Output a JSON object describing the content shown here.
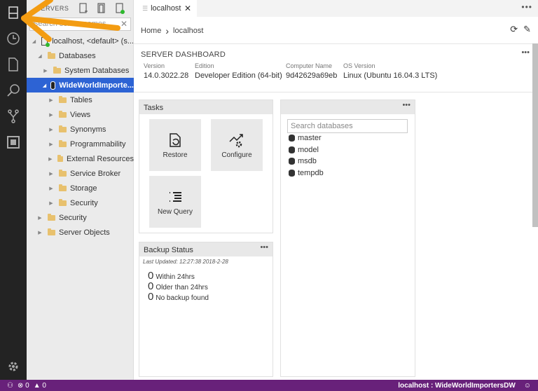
{
  "sidebar": {
    "header": "SERVERS",
    "search_placeholder": "Search server names",
    "tree": [
      {
        "label": "localhost, <default> (s...",
        "level": 0,
        "expanded": true,
        "icon": "server-icon"
      },
      {
        "label": "Databases",
        "level": 1,
        "expanded": true,
        "icon": "folder-icon"
      },
      {
        "label": "System Databases",
        "level": 2,
        "expanded": false,
        "icon": "folder-icon"
      },
      {
        "label": "WideWorldImporte...",
        "level": 2,
        "expanded": true,
        "icon": "database-icon",
        "selected": true
      },
      {
        "label": "Tables",
        "level": 3,
        "expanded": false,
        "icon": "folder-icon"
      },
      {
        "label": "Views",
        "level": 3,
        "expanded": false,
        "icon": "folder-icon"
      },
      {
        "label": "Synonyms",
        "level": 3,
        "expanded": false,
        "icon": "folder-icon"
      },
      {
        "label": "Programmability",
        "level": 3,
        "expanded": false,
        "icon": "folder-icon"
      },
      {
        "label": "External Resources",
        "level": 3,
        "expanded": false,
        "icon": "folder-icon"
      },
      {
        "label": "Service Broker",
        "level": 3,
        "expanded": false,
        "icon": "folder-icon"
      },
      {
        "label": "Storage",
        "level": 3,
        "expanded": false,
        "icon": "folder-icon"
      },
      {
        "label": "Security",
        "level": 3,
        "expanded": false,
        "icon": "folder-icon"
      },
      {
        "label": "Security",
        "level": 1,
        "expanded": false,
        "icon": "folder-icon"
      },
      {
        "label": "Server Objects",
        "level": 1,
        "expanded": false,
        "icon": "folder-icon"
      }
    ]
  },
  "tabs": [
    {
      "label": "localhost",
      "close": "✕"
    }
  ],
  "tab_more": "•••",
  "breadcrumb": {
    "home": "Home",
    "sep": "›",
    "current": "localhost"
  },
  "dashboard": {
    "title": "SERVER DASHBOARD",
    "more": "•••",
    "props": [
      {
        "label": "Version",
        "value": "14.0.3022.28"
      },
      {
        "label": "Edition",
        "value": "Developer Edition (64-bit)"
      },
      {
        "label": "Computer Name",
        "value": "9d42629a69eb"
      },
      {
        "label": "OS Version",
        "value": "Linux (Ubuntu 16.04.3 LTS)"
      }
    ]
  },
  "tasks": {
    "title": "Tasks",
    "items": [
      {
        "label": "Restore",
        "icon": "restore-icon"
      },
      {
        "label": "Configure",
        "icon": "configure-icon"
      },
      {
        "label": "New Query",
        "icon": "new-query-icon"
      }
    ]
  },
  "databases": {
    "more": "•••",
    "search_placeholder": "Search databases",
    "items": [
      "master",
      "model",
      "msdb",
      "tempdb"
    ]
  },
  "backup": {
    "title": "Backup Status",
    "more": "•••",
    "last_updated": "Last Updated: 12:27:38 2018-2-28",
    "rows": [
      {
        "count": "0",
        "label": "Within 24hrs"
      },
      {
        "count": "0",
        "label": "Older than 24hrs"
      },
      {
        "count": "0",
        "label": "No backup found"
      }
    ]
  },
  "status": {
    "errors": "0",
    "warnings": "0",
    "connection": "localhost : WideWorldImportersDW"
  },
  "colors": {
    "accent": "#68217a",
    "selection": "#2d63d4",
    "annotation_arrow": "#f39c12"
  }
}
